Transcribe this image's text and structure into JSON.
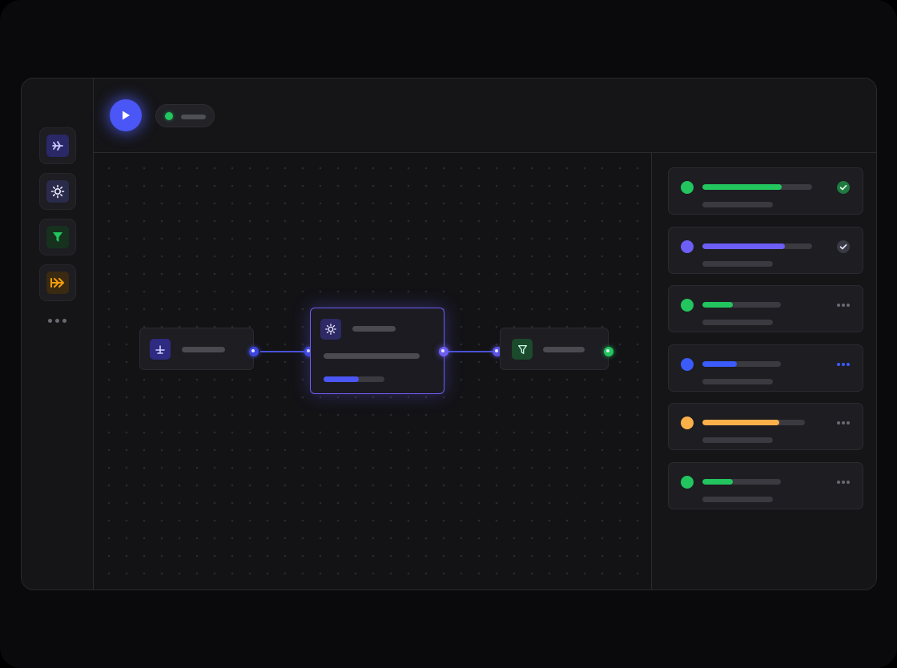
{
  "app": {
    "title": ""
  },
  "toolbar": {
    "play_icon": "play-icon",
    "status_color": "#22c55e"
  },
  "sidebar": {
    "tools": [
      {
        "icon": "plane-icon",
        "color": "#8b8cff"
      },
      {
        "icon": "sun-icon",
        "color": "#e5e5ff"
      },
      {
        "icon": "filter-icon",
        "color": "#22c55e"
      },
      {
        "icon": "arrow-right-icon",
        "color": "#f59e0b"
      }
    ],
    "more_icon": "more-horizontal-icon"
  },
  "workflow": {
    "nodes": [
      {
        "id": "trigger",
        "icon": "plane-icon",
        "accent": "#4f46e5"
      },
      {
        "id": "transform",
        "icon": "sun-icon",
        "accent": "#6d5ef5",
        "selected": true,
        "progress": 0.58
      },
      {
        "id": "filter",
        "icon": "filter-icon",
        "accent": "#22c55e"
      }
    ]
  },
  "runs": [
    {
      "color": "#22c55e",
      "progress": 0.72,
      "status": "done",
      "status_icon": "check-circle-icon"
    },
    {
      "color": "#6d5ef5",
      "progress": 0.75,
      "status": "done",
      "status_icon": "check-circle-icon"
    },
    {
      "color": "#22c55e",
      "progress": 0.39,
      "status": "idle",
      "status_icon": "more-horizontal-icon"
    },
    {
      "color": "#3b5bfb",
      "progress": 0.44,
      "status": "running",
      "status_icon": "more-horizontal-icon"
    },
    {
      "color": "#fbb04a",
      "progress": 0.75,
      "status": "idle",
      "status_icon": "more-horizontal-icon"
    },
    {
      "color": "#22c55e",
      "progress": 0.39,
      "status": "idle",
      "status_icon": "more-horizontal-icon"
    }
  ],
  "colors": {
    "accent": "#4a56f5",
    "selected_border": "#6d5ef5",
    "success": "#22c55e",
    "warning": "#fbb04a",
    "running": "#3b5bfb",
    "background": "#151518"
  }
}
